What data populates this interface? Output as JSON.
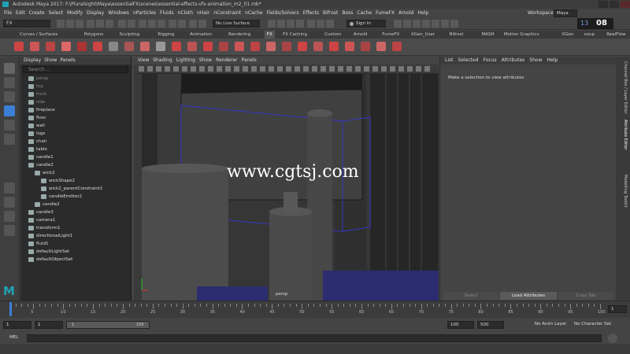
{
  "window": {
    "title": "Autodesk Maya 2017: F:\\Pluralsight\\Maya\\essentialFX\\scenes\\essential-effects-vfx-animation_m2_01.mb*"
  },
  "menubar": {
    "items": [
      "File",
      "Edit",
      "Create",
      "Select",
      "Modify",
      "Display",
      "Windows",
      "nParticles",
      "Fluids",
      "nCloth",
      "nHair",
      "nConstraint",
      "nCache",
      "Fields/Solvers",
      "Effects",
      "Bifrost",
      "Boss",
      "Cache",
      "FumeFX",
      "Arnold",
      "Help"
    ],
    "workspace_label": "Workspace :",
    "workspace_value": "Maya"
  },
  "statusline": {
    "menuset": "FX",
    "live_surface": "No Live Surface",
    "sign_in": "Sign In",
    "clock_hour": "08",
    "clock_day": "13"
  },
  "shelf": {
    "tabs": [
      "Curves / Surfaces",
      "Polygons",
      "Sculpting",
      "Rigging",
      "Animation",
      "Rendering",
      "FX",
      "FX Caching",
      "Custom",
      "Arnold",
      "FumeFX",
      "XGen_User",
      "Bifrost",
      "MASH",
      "Motion Graphics",
      "XGen",
      "soup",
      "RealFlow"
    ],
    "active_tab": "FX"
  },
  "outliner": {
    "menu": [
      "Display",
      "Show",
      "Panels"
    ],
    "search_placeholder": "Search...",
    "items": [
      {
        "label": "persp",
        "indent": 0,
        "dim": true
      },
      {
        "label": "top",
        "indent": 0,
        "dim": true
      },
      {
        "label": "front",
        "indent": 0,
        "dim": true
      },
      {
        "label": "side",
        "indent": 0,
        "dim": true
      },
      {
        "label": "fireplace",
        "indent": 0,
        "dim": false
      },
      {
        "label": "floor",
        "indent": 0,
        "dim": false
      },
      {
        "label": "wall",
        "indent": 0,
        "dim": false
      },
      {
        "label": "logs",
        "indent": 0,
        "dim": false
      },
      {
        "label": "chair",
        "indent": 0,
        "dim": false
      },
      {
        "label": "table",
        "indent": 0,
        "dim": false
      },
      {
        "label": "candle1",
        "indent": 0,
        "dim": false
      },
      {
        "label": "candle2",
        "indent": 0,
        "dim": false
      },
      {
        "label": "wick2",
        "indent": 1,
        "dim": false
      },
      {
        "label": "wickShape2",
        "indent": 2,
        "dim": false
      },
      {
        "label": "wick2_parentConstraint1",
        "indent": 2,
        "dim": false
      },
      {
        "label": "candleEmitter2",
        "indent": 2,
        "dim": false
      },
      {
        "label": "candle2",
        "indent": 1,
        "dim": false
      },
      {
        "label": "candle3",
        "indent": 0,
        "dim": false
      },
      {
        "label": "camera1",
        "indent": 0,
        "dim": false
      },
      {
        "label": "transform1",
        "indent": 0,
        "dim": false
      },
      {
        "label": "directionalLight1",
        "indent": 0,
        "dim": false
      },
      {
        "label": "fluid1",
        "indent": 0,
        "dim": false
      },
      {
        "label": "defaultLightSet",
        "indent": 0,
        "dim": false
      },
      {
        "label": "defaultObjectSet",
        "indent": 0,
        "dim": false
      }
    ]
  },
  "viewport": {
    "menu": [
      "View",
      "Shading",
      "Lighting",
      "Show",
      "Renderer",
      "Panels"
    ],
    "camera_label": "persp",
    "watermark": "www.cgtsj.com"
  },
  "attribute_editor": {
    "menu": [
      "List",
      "Selected",
      "Focus",
      "Attributes",
      "Show",
      "Help"
    ],
    "message": "Make a selection to view attributes",
    "buttons": [
      "Select",
      "Load Attributes",
      "Copy Tab"
    ]
  },
  "side_tabs": [
    "Channel Box / Layer Editor",
    "Attribute Editor",
    "Modelling Toolkit"
  ],
  "timeslider": {
    "ticks": [
      "5",
      "10",
      "15",
      "20",
      "25",
      "30",
      "35",
      "40",
      "45",
      "50",
      "55",
      "60",
      "65",
      "70",
      "75",
      "80",
      "85",
      "90",
      "95",
      "100"
    ],
    "current_frame": "1"
  },
  "rangebar": {
    "start": "1",
    "range_start": "1",
    "range_handle": "1",
    "range_end": "100",
    "end": "100",
    "anim_end": "500",
    "anim_layer": "No Anim Layer",
    "char_set": "No Character Set"
  },
  "cmdline": {
    "label": "MEL"
  },
  "colors": {
    "panel": "#444444",
    "dark": "#2b2b2b",
    "accent_blue": "#3c7fd6",
    "grid_blue": "#3535c8"
  }
}
